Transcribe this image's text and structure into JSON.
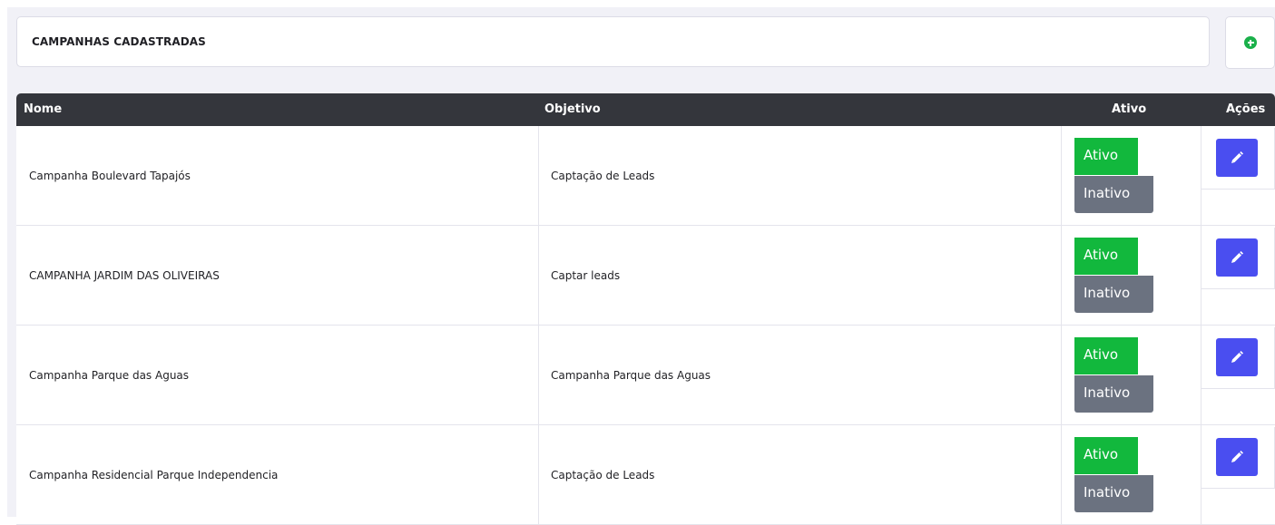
{
  "header": {
    "title": "CAMPANHAS CADASTRADAS",
    "add_icon": "plus-circle-icon",
    "add_icon_color": "#1ab04a"
  },
  "table": {
    "columns": [
      "Nome",
      "Objetivo",
      "Ativo",
      "Ações"
    ],
    "rows": [
      {
        "nome": "Campanha Boulevard Tapajós",
        "objetivo": "Captação de Leads",
        "ativo_label": "Ativo",
        "inativo_label": "Inativo"
      },
      {
        "nome": "CAMPANHA JARDIM DAS OLIVEIRAS",
        "objetivo": "Captar leads",
        "ativo_label": "Ativo",
        "inativo_label": "Inativo"
      },
      {
        "nome": "Campanha Parque das Aguas",
        "objetivo": "Campanha Parque das Aguas",
        "ativo_label": "Ativo",
        "inativo_label": "Inativo"
      },
      {
        "nome": "Campanha Residencial Parque Independencia",
        "objetivo": "Captação de Leads",
        "ativo_label": "Ativo",
        "inativo_label": "Inativo"
      }
    ],
    "action_icon": "pencil-icon"
  },
  "colors": {
    "header_bg": "#34363c",
    "ativo": "#12b83d",
    "inativo": "#6b7280",
    "edit": "#4a4ef0"
  }
}
